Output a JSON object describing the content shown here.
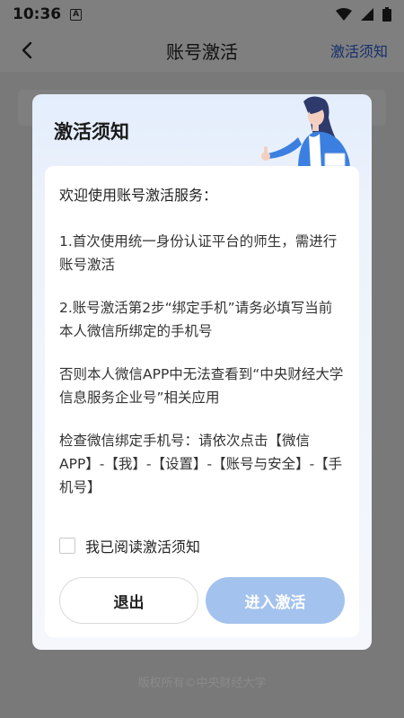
{
  "status_bar": {
    "time": "10:36",
    "notification_glyph": "A",
    "icons": [
      "wifi-icon",
      "signal-icon",
      "battery-icon"
    ]
  },
  "header": {
    "title": "账号激活",
    "right_link": "激活须知"
  },
  "footer": {
    "copyright": "版权所有©中央财经大学"
  },
  "modal": {
    "title": "激活须知",
    "heading": "欢迎使用账号激活服务：",
    "paragraphs": [
      "1.首次使用统一身份认证平台的师生，需进行账号激活",
      "2.账号激活第2步“绑定手机”请务必填写当前本人微信所绑定的手机号",
      "否则本人微信APP中无法查看到“中央财经大学信息服务企业号”相关应用",
      "检查微信绑定手机号：请依次点击【微信APP】-【我】-【设置】-【账号与安全】-【手机号】"
    ],
    "agree_label": "我已阅读激活须知",
    "agree_checked": false,
    "exit_button": "退出",
    "enter_button": "进入激活"
  },
  "colors": {
    "accent": "#2b5dd8",
    "enter_button_disabled": "#a3c2ee",
    "overlay": "rgba(0,0,0,0.5)"
  }
}
